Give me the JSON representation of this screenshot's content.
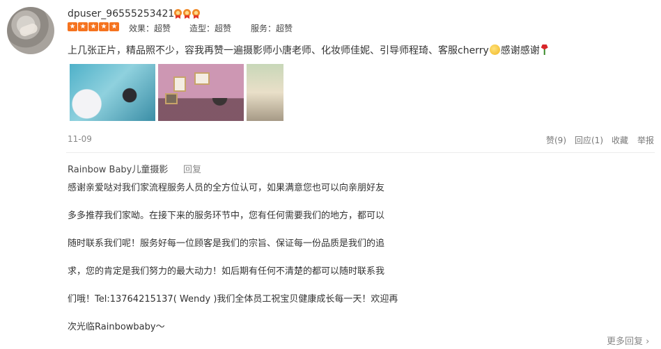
{
  "user": {
    "name": "dpuser_96555253421"
  },
  "rating": {
    "stars": 5,
    "scores": [
      {
        "label": "效果：超赞"
      },
      {
        "label": "造型：超赞"
      },
      {
        "label": "服务：超赞"
      }
    ]
  },
  "review": {
    "text_before_emoji": "上几张正片，精品照不少，容我再赞一遍摄影师小唐老师、化妆师佳妮、引导师程琦、客服cherry",
    "text_after_emoji": "感谢感谢"
  },
  "date": "11-09",
  "actions": {
    "like": "赞(9)",
    "reply": "回应(1)",
    "favorite": "收藏",
    "report": "举报"
  },
  "merchant_reply": {
    "merchant_name": "Rainbow Baby儿童摄影",
    "reply_label": "回复",
    "lines": [
      "感谢亲爱哒对我们家流程服务人员的全方位认可，如果满意您也可以向亲朋好友",
      "多多推荐我们家呦。在接下来的服务环节中，您有任何需要我们的地方，都可以",
      "随时联系我们呢！服务好每一位顾客是我们的宗旨、保证每一份品质是我们的追",
      "求，您的肯定是我们努力的最大动力！如后期有任何不清楚的都可以随时联系我",
      "们哦！Tel:13764215137( Wendy )我们全体员工祝宝贝健康成长每一天！欢迎再",
      "次光临Rainbowbaby～"
    ]
  },
  "more_replies": "更多回复 ›",
  "icons": {
    "medal": "medal-icon",
    "star": "star-icon",
    "emoji_face": "thinking-face-emoji",
    "emoji_rose": "rose-emoji"
  },
  "colors": {
    "star_orange": "#f5731f",
    "text_main": "#333333",
    "text_muted": "#888888"
  }
}
